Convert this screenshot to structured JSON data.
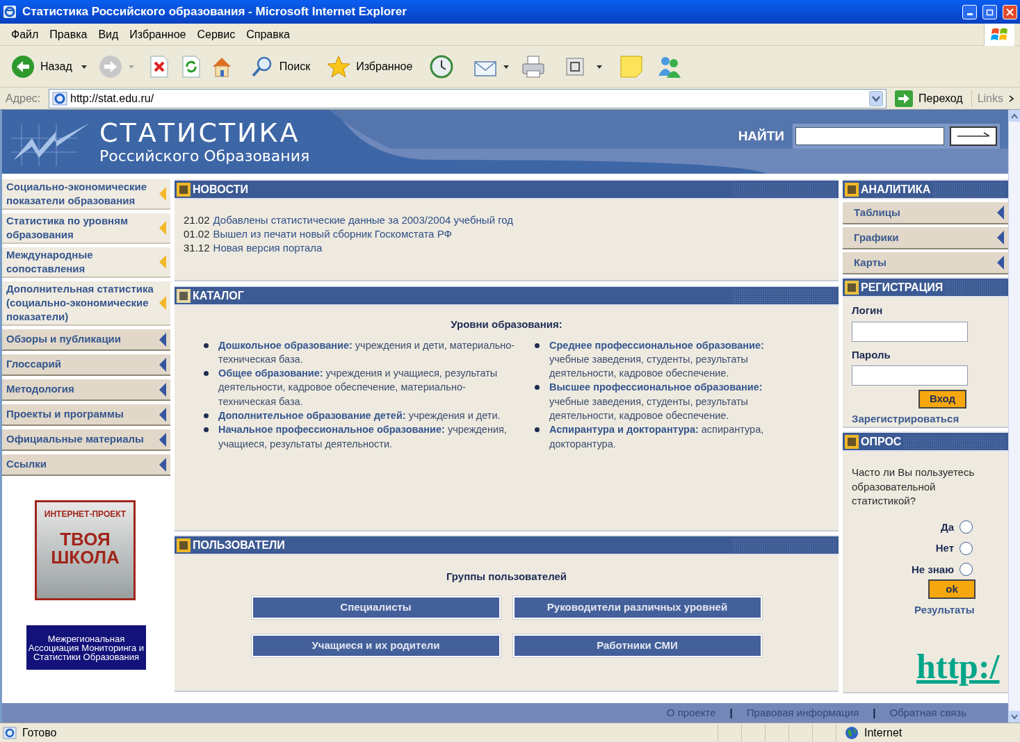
{
  "window": {
    "title": "Статистика Российского образования - Microsoft Internet Explorer"
  },
  "menu": [
    "Файл",
    "Правка",
    "Вид",
    "Избранное",
    "Сервис",
    "Справка"
  ],
  "toolbar": {
    "back": "Назад",
    "search": "Поиск",
    "favorites": "Избранное"
  },
  "address": {
    "label": "Адрес:",
    "url": "http://stat.edu.ru/",
    "go": "Переход",
    "links": "Links"
  },
  "site": {
    "logo_line1": "СТАТИСТИКА",
    "logo_line2": "Российского Образования",
    "search_label": "НАЙТИ"
  },
  "left_menu": [
    {
      "label": "Социально-экономические показатели образования",
      "kind": "primary"
    },
    {
      "label": "Статистика по уровням образования",
      "kind": "primary"
    },
    {
      "label": "Международные сопоставления",
      "kind": "primary"
    },
    {
      "label": "Дополнительная статистика (социально-экономические показатели)",
      "kind": "primary"
    },
    {
      "label": "Обзоры и публикации",
      "kind": "secondary"
    },
    {
      "label": "Глоссарий",
      "kind": "secondary"
    },
    {
      "label": "Методология",
      "kind": "secondary"
    },
    {
      "label": "Проекты и программы",
      "kind": "secondary"
    },
    {
      "label": "Официальные материалы",
      "kind": "secondary"
    },
    {
      "label": "Ссылки",
      "kind": "secondary"
    }
  ],
  "banners": {
    "project_top": "ИНТЕРНЕТ-ПРОЕКТ",
    "project_main": "ТВОЯ ШКОЛА",
    "association": "Межрегиональная Ассоциация Мониторинга и Статистики Образования"
  },
  "news": {
    "title": "НОВОСТИ",
    "items": [
      {
        "date": "21.02",
        "text": "Добавлены статистические данные за 2003/2004 учебный год"
      },
      {
        "date": "01.02",
        "text": "Вышел из печати новый сборник Госкомстата РФ"
      },
      {
        "date": "31.12",
        "text": "Новая версия портала"
      }
    ]
  },
  "catalog": {
    "title": "КАТАЛОГ",
    "heading": "Уровни образования:",
    "columns": [
      [
        "**Дошкольное образование:** учреждения и дети, материально-техническая база.",
        "**Общее образование:** учреждения и учащиеся, результаты деятельности, кадровое обеспечение, материально-техническая база.",
        "**Дополнительное образование детей:** учреждения и дети.",
        "**Начальное профессиональное образование:** учреждения, учащиеся, результаты деятельности."
      ],
      [
        "**Среднее профессиональное образование:** учебные заведения, студенты, результаты деятельности, кадровое обеспечение.",
        "**Высшее профессиональное образование:** учебные заведения, студенты, результаты деятельности, кадровое обеспечение.",
        "**Аспирантура и докторантура:** аспирантура, докторантура."
      ]
    ]
  },
  "users": {
    "title": "ПОЛЬЗОВАТЕЛИ",
    "heading": "Группы пользователей",
    "buttons": [
      "Специалисты",
      "Руководители различных уровней",
      "Учащиеся и их родители",
      "Работники СМИ"
    ]
  },
  "analytics": {
    "title": "АНАЛИТИКА",
    "items": [
      "Таблицы",
      "Графики",
      "Карты"
    ]
  },
  "registration": {
    "title": "РЕГИСТРАЦИЯ",
    "login_label": "Логин",
    "password_label": "Пароль",
    "submit": "Вход",
    "register": "Зарегистрироваться"
  },
  "poll": {
    "title": "ОПРОС",
    "question": "Часто ли Вы пользуетесь образовательной статистикой?",
    "options": [
      {
        "label": "Да",
        "selected": false
      },
      {
        "label": "Нет",
        "selected": false
      },
      {
        "label": "Не знаю",
        "selected": false
      }
    ],
    "submit": "ok",
    "results": "Результаты"
  },
  "footer": [
    {
      "kind": "link",
      "text": "О проекте"
    },
    {
      "kind": "separator",
      "text": "|"
    },
    {
      "kind": "link",
      "text": "Правовая информация"
    },
    {
      "kind": "separator",
      "text": "|"
    },
    {
      "kind": "link",
      "text": "Обратная связь"
    }
  ],
  "status_bar": {
    "text": "Готово",
    "zone": "Internet"
  },
  "overlay_link": "http:/"
}
